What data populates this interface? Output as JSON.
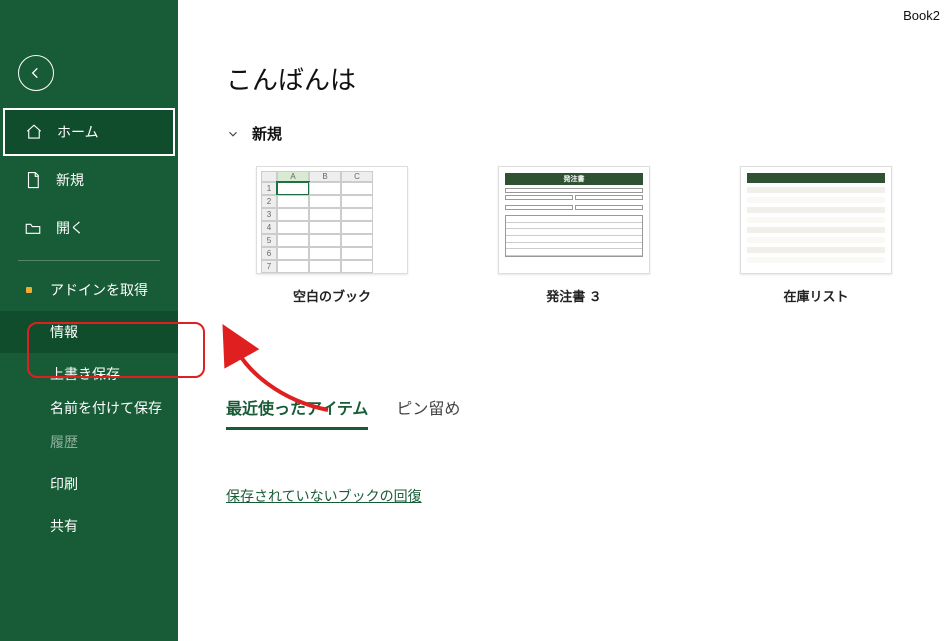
{
  "window": {
    "title": "Book2"
  },
  "greeting": "こんばんは",
  "section_new": "新規",
  "sidebar": {
    "home": "ホーム",
    "new": "新規",
    "open": "開く",
    "get_addins": "アドインを取得",
    "info": "情報",
    "overwrite_save": "上書き保存",
    "save_as": "名前を付けて保存",
    "history": "履歴",
    "print": "印刷",
    "share": "共有"
  },
  "templates": [
    {
      "label": "空白のブック",
      "cols": [
        "A",
        "B",
        "C"
      ],
      "rows": [
        "1",
        "2",
        "3",
        "4",
        "5",
        "6",
        "7"
      ]
    },
    {
      "label": "発注書 ３",
      "title": "発注書"
    },
    {
      "label": "在庫リスト"
    }
  ],
  "tabs": {
    "recent": "最近使ったアイテム",
    "pinned": "ピン留め"
  },
  "recover_link": "保存されていないブックの回復"
}
